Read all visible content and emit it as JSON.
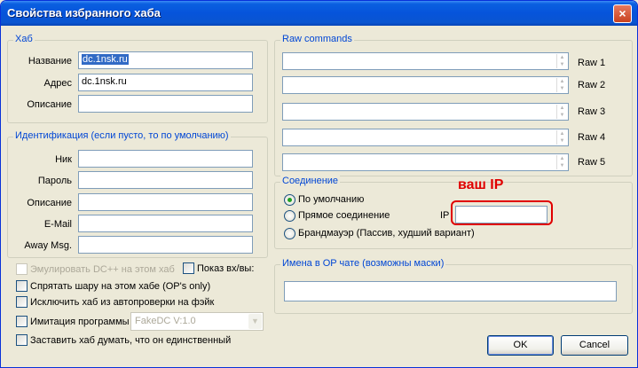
{
  "window": {
    "title": "Свойства избранного хаба",
    "close_icon": "×"
  },
  "hub": {
    "legend": "Хаб",
    "name_label": "Название",
    "name_value": "dc.1nsk.ru",
    "address_label": "Адрес",
    "address_value": "dc.1nsk.ru",
    "description_label": "Описание",
    "description_value": ""
  },
  "identity": {
    "legend": "Идентификация (если пусто, то по умолчанию)",
    "nick_label": "Ник",
    "nick_value": "",
    "password_label": "Пароль",
    "password_value": "",
    "description_label": "Описание",
    "description_value": "",
    "email_label": "E-Mail",
    "email_value": "",
    "away_label": "Away Msg.",
    "away_value": ""
  },
  "options": {
    "emulate_dc": "Эмулировать DC++ на этом хабе",
    "show_inout": "Показ вх/вы:",
    "hide_share": "Спрятать шару на этом хабе (OP's only)",
    "exclude_fake": "Исключить хаб из автопроверки на фэйк",
    "imitate_program": "Имитация программы",
    "program_value": "FakeDC V:1.0",
    "force_unique": "Заставить хаб думать, что он единственный"
  },
  "raw": {
    "legend": "Raw commands",
    "labels": [
      "Raw 1",
      "Raw 2",
      "Raw 3",
      "Raw 4",
      "Raw 5"
    ]
  },
  "connection": {
    "legend": "Соединение",
    "default": "По умолчанию",
    "direct": "Прямое соединение",
    "firewall": "Брандмауэр (Пассив, худший вариант)",
    "ip_label": "IP",
    "ip_value": "",
    "selected": "default"
  },
  "annotation": {
    "text": "ваш IP",
    "color": "#e00000"
  },
  "op_chat": {
    "legend": "Имена в OP чате (возможны маски)",
    "value": ""
  },
  "buttons": {
    "ok": "OK",
    "cancel": "Cancel"
  },
  "colors": {
    "titlebar": "#0654db",
    "legend": "#0046d5",
    "face": "#ece9d8"
  }
}
